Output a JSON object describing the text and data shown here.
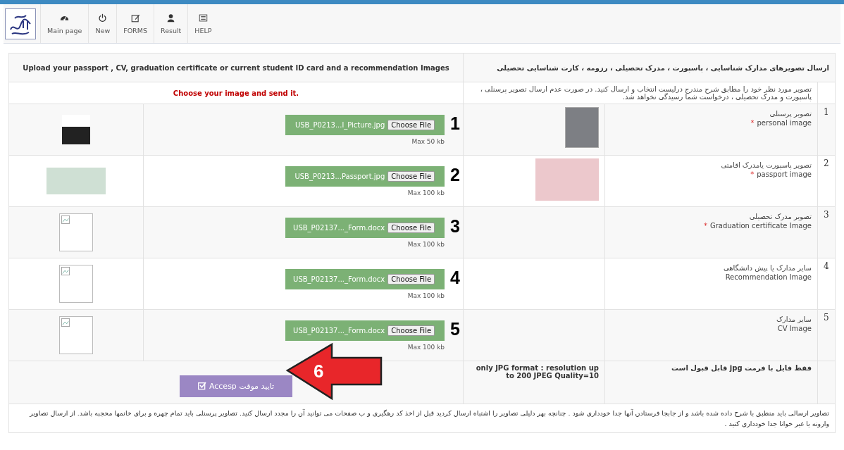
{
  "nav": [
    {
      "label": "Main page",
      "kind": "dashboard"
    },
    {
      "label": "New",
      "kind": "power"
    },
    {
      "label": "FORMS",
      "kind": "edit"
    },
    {
      "label": "Result",
      "kind": "user"
    },
    {
      "label": "HELP",
      "kind": "list"
    }
  ],
  "header": {
    "left": "Upload your passport , CV, graduation certificate or current student ID card and a recommendation Images",
    "right": "ارسال تصویرهای مدارک شناسایی ، پاسپورت ، مدرک تحصیلی ، رزومه ، کارت شناسایی تحصیلی"
  },
  "instruction": {
    "left": "Choose your image and send it.",
    "right": "تصویر مورد نظر خود را مطابق شرح مندرج درلیست انتخاب و ارسال کنید. در صورت عدم ارسال تصویر پرسنلی ، پاسپورت و مدرک تحصیلی ، درخواست شما رسیدگی نخواهد شد."
  },
  "rows": [
    {
      "number": "1",
      "annotation": "1",
      "kind": "photo",
      "file_name": "USB_P0213...l_Picture.jpg",
      "button": "Choose File",
      "max": "Max 50 kb",
      "title_fa": "تصویر پرسنلی",
      "required_mark": "*",
      "title_en": "personal image"
    },
    {
      "number": "2",
      "annotation": "2",
      "kind": "passport",
      "file_name": "USB_P0213...Passport.jpg",
      "button": "Choose File",
      "max": "Max 100 kb",
      "title_fa": "تصویر پاسپورت یامدرک اقامتی",
      "required_mark": "*",
      "title_en": "passport image"
    },
    {
      "number": "3",
      "annotation": "3",
      "kind": "document",
      "file_name": "USB_P02137..._Form.docx",
      "button": "Choose File",
      "max": "Max 100 kb",
      "title_fa": "تصویر مدرک تحصیلی",
      "required_mark": "*",
      "title_en": "Graduation certificate Image"
    },
    {
      "number": "4",
      "annotation": "4",
      "kind": "document",
      "file_name": "USB_P02137..._Form.docx",
      "button": "Choose File",
      "max": "Max 100 kb",
      "title_fa": "سایر مدارک یا پیش دانشگاهی",
      "title_en": "Recommendation Image"
    },
    {
      "number": "5",
      "annotation": "5",
      "kind": "document",
      "file_name": "USB_P02137..._Form.docx",
      "button": "Choose File",
      "max": "Max 100 kb",
      "title_fa": "سایر مدارک",
      "title_en": "CV Image"
    }
  ],
  "summary": {
    "button": "Accesp تایید موقت",
    "note_en": "only JPG format : resolution up to 200    JPEG Quality=10",
    "note_fa": "فقط فایل با فرمت jpg قابل قبول است"
  },
  "arrow_annotation": "6",
  "footer": "تصاویر ارسالی باید منطبق با شرح داده شده باشد و از جابجا فرستادن آنها جدا خودداری شود . چنانچه بهر دلیلی تصاویر را اشتباه ارسال کردید قبل از اخذ کد رهگیری و ب صفحات می توانید آن را مجدد ارسال کنید.  تصاویر پرسنلی باید تمام چهره و برای خانمها محجبه باشد. از ارسال تصاویر وارونه یا غیر خوانا جدا خودداری کنید ."
}
